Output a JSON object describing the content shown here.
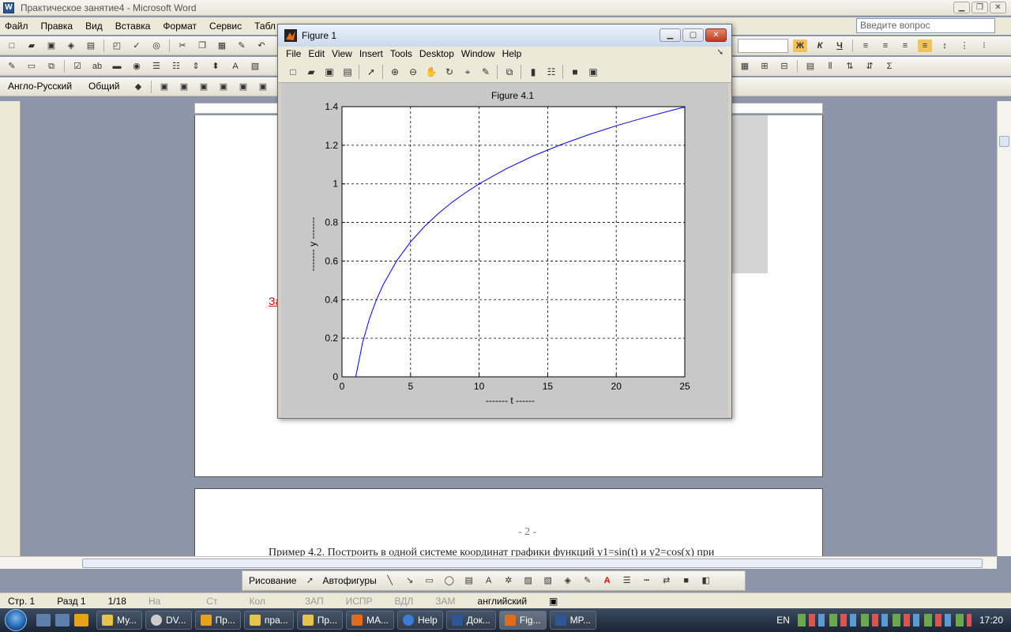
{
  "word": {
    "title": "Практическое занятие4 - Microsoft Word",
    "menu": [
      "Файл",
      "Правка",
      "Вид",
      "Вставка",
      "Формат",
      "Сервис",
      "Табл"
    ],
    "help_placeholder": "Введите вопрос",
    "lang_combo": "Англо-Русский",
    "style_combo": "Общий",
    "red_text": "За",
    "page_number": "- 2 -",
    "page_text": "Пример 4.2. Построить в одной системе координат графики функций y1=sin(t) и  y2=cos(x) при",
    "status": {
      "page": "Стр. 1",
      "section": "Разд 1",
      "pages": "1/18",
      "at": "На",
      "line": "Ст",
      "col": "Кол",
      "rec": "ЗАП",
      "trk": "ИСПР",
      "ext": "ВДЛ",
      "ovr": "ЗАМ",
      "language": "английский"
    },
    "drawing": {
      "draw_label": "Рисование",
      "autoshapes_label": "Автофигуры"
    }
  },
  "figure": {
    "window_title": "Figure 1",
    "menu": [
      "File",
      "Edit",
      "View",
      "Insert",
      "Tools",
      "Desktop",
      "Window",
      "Help"
    ]
  },
  "chart_data": {
    "type": "line",
    "title": "Figure 4.1",
    "xlabel": "------- t ------",
    "ylabel": "------- y -------",
    "xlim": [
      0,
      25
    ],
    "ylim": [
      0,
      1.4
    ],
    "xticks": [
      0,
      5,
      10,
      15,
      20,
      25
    ],
    "yticks": [
      0,
      0.2,
      0.4,
      0.6,
      0.8,
      1,
      1.2,
      1.4
    ],
    "grid": true,
    "line_color": "#0000ff",
    "series": [
      {
        "x": [
          1,
          1.5,
          2,
          2.5,
          3,
          4,
          5,
          6,
          7,
          8,
          9,
          10,
          12,
          14,
          16,
          18,
          20,
          22,
          24,
          25
        ],
        "values": [
          0,
          0.176,
          0.301,
          0.398,
          0.477,
          0.602,
          0.699,
          0.778,
          0.845,
          0.903,
          0.954,
          1.0,
          1.079,
          1.146,
          1.204,
          1.255,
          1.301,
          1.342,
          1.38,
          1.398
        ]
      }
    ]
  },
  "taskbar": {
    "tasks": [
      "Му...",
      "DV...",
      "Пр...",
      "пра...",
      "Пр...",
      "MA...",
      "Help",
      "Док...",
      "Fig...",
      "MP..."
    ],
    "lang": "EN",
    "clock": "17:20"
  }
}
